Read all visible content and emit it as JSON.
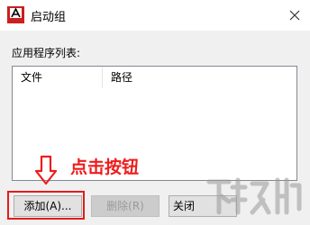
{
  "window": {
    "title": "启动组",
    "app_icon": "autocad-icon",
    "close_glyph": "✕"
  },
  "list": {
    "label": "应用程序列表:",
    "columns": [
      "文件",
      "路径"
    ],
    "rows": []
  },
  "annotation": {
    "text": "点击按钮",
    "color": "#ee1c1c",
    "arrow_icon": "down-arrow-icon"
  },
  "buttons": {
    "add": "添加(A)...",
    "remove": "删除(R)",
    "close": "关闭"
  },
  "colors": {
    "highlight": "#e21c1c",
    "app_icon_red": "#cc1f1f"
  }
}
